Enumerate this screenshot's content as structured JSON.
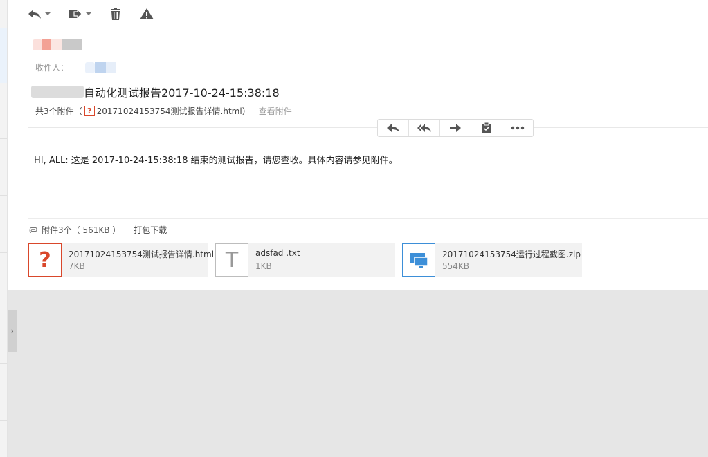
{
  "toolbar": {
    "reply_icon": "reply-icon",
    "forward_icon": "forward-icon",
    "delete_icon": "trash-icon",
    "report_icon": "warning-icon"
  },
  "mail": {
    "recipient_label": "收件人：",
    "subject": "自动化测试报告2017-10-24-15:38:18",
    "attach_summary_prefix": "共3个附件（",
    "attach_summary_file": "20171024153754测试报告详情.html",
    "attach_summary_suffix": "）",
    "view_attachments": "查看附件",
    "body": "HI, ALL: 这是 2017-10-24-15:38:18 结束的测试报告，请您查收。具体内容请参见附件。"
  },
  "actions": [
    "reply-icon",
    "reply-all-icon",
    "forward-icon",
    "clipboard-icon",
    "more-icon"
  ],
  "attachments": {
    "header": "附件3个（ 561KB ）",
    "download_all": "打包下载",
    "items": [
      {
        "name": "20171024153754测试报告详情.html",
        "size": "7KB",
        "icon": "unknown-file-icon",
        "color": "#d9472b",
        "glyph": "?"
      },
      {
        "name": "adsfad .txt",
        "size": "1KB",
        "icon": "text-file-icon",
        "color": "#999999",
        "glyph": "T"
      },
      {
        "name": "20171024153754运行过程截图.zip",
        "size": "554KB",
        "icon": "archive-file-icon",
        "color": "#3d8fd8",
        "glyph": ""
      }
    ]
  },
  "colors": {
    "accent_red": "#d9472b",
    "accent_blue": "#3d8fd8",
    "pane_bg": "#ffffff",
    "empty_bg": "#e6e6e6"
  }
}
